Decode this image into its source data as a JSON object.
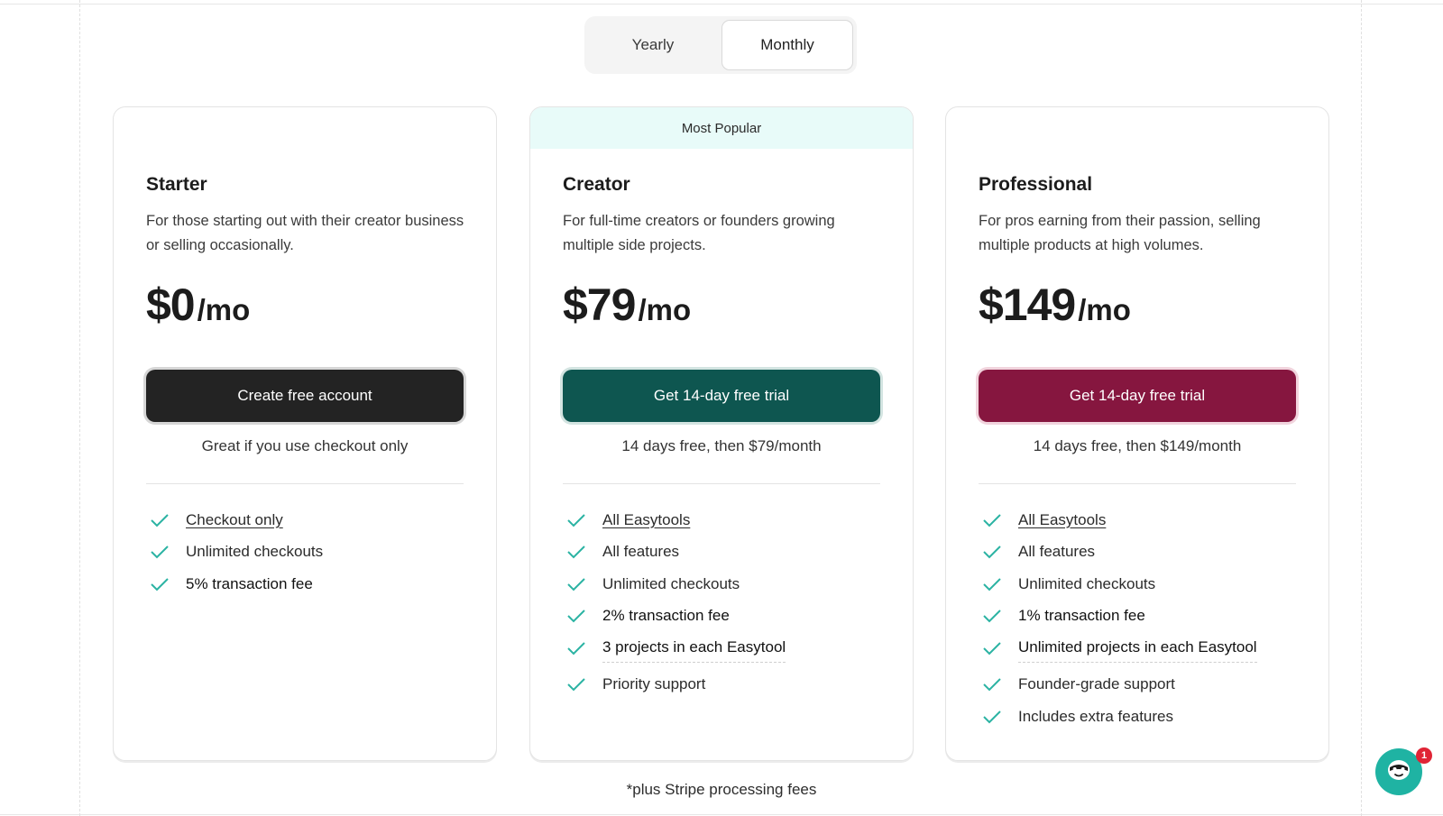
{
  "billing_toggle": {
    "options": [
      "Yearly",
      "Monthly"
    ],
    "selected": "Monthly"
  },
  "plans": [
    {
      "badge": "",
      "name": "Starter",
      "description": "For those starting out with their creator business or selling occasionally.",
      "price": "$0",
      "unit": "/mo",
      "cta": "Create free account",
      "cta_color": "#232323",
      "note": "Great if you use checkout only",
      "features": [
        "Checkout only",
        "Unlimited checkouts",
        "5% transaction fee"
      ]
    },
    {
      "badge": "Most Popular",
      "name": "Creator",
      "description": "For full-time creators or founders growing multiple side projects.",
      "price": "$79",
      "unit": "/mo",
      "cta": "Get 14-day free trial",
      "cta_color": "#0e5650",
      "note": "14 days free, then $79/month",
      "features": [
        "All Easytools",
        "All features",
        "Unlimited checkouts",
        "2% transaction fee",
        "3 projects in each Easytool",
        "Priority support"
      ]
    },
    {
      "badge": "",
      "name": "Professional",
      "description": "For pros earning from their passion, selling multiple products at high volumes.",
      "price": "$149",
      "unit": "/mo",
      "cta": "Get 14-day free trial",
      "cta_color": "#86163f",
      "note": "14 days free, then $149/month",
      "features": [
        "All Easytools",
        "All features",
        "Unlimited checkouts",
        "1% transaction fee",
        "Unlimited projects in each Easytool",
        "Founder-grade support",
        "Includes extra features"
      ]
    }
  ],
  "footnote": "*plus Stripe processing fees",
  "chat": {
    "icon": "chat-mascot-icon",
    "unread_count": "1"
  },
  "colors": {
    "check": "#2bb3a3",
    "popular_banner": "#e8fbf9"
  }
}
